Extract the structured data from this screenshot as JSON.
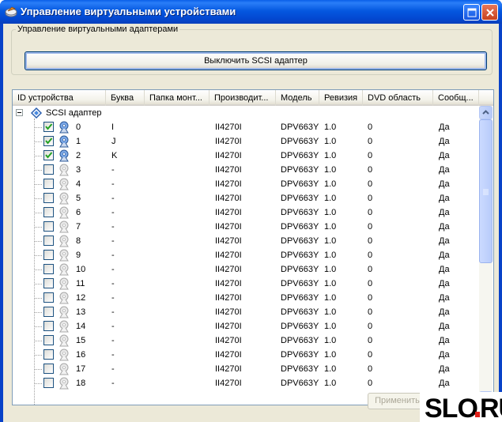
{
  "window": {
    "title": "Управление виртуальными устройствами"
  },
  "adapters_group": {
    "label": "Управление виртуальными адаптерами",
    "disable_button": "Выключить SCSI адаптер"
  },
  "columns": [
    "ID устройства",
    "Буква",
    "Папка монт...",
    "Производит...",
    "Модель",
    "Ревизия",
    "DVD область",
    "Сообщ..."
  ],
  "tree_root": "SCSI адаптер",
  "devices": [
    {
      "id": "0",
      "letter": "I",
      "folder": "",
      "vendor": "II4270I",
      "model": "DPV663Y",
      "revision": "1.0",
      "dvd_region": "0",
      "notify": "Да",
      "checked": true
    },
    {
      "id": "1",
      "letter": "J",
      "folder": "",
      "vendor": "II4270I",
      "model": "DPV663Y",
      "revision": "1.0",
      "dvd_region": "0",
      "notify": "Да",
      "checked": true
    },
    {
      "id": "2",
      "letter": "K",
      "folder": "",
      "vendor": "II4270I",
      "model": "DPV663Y",
      "revision": "1.0",
      "dvd_region": "0",
      "notify": "Да",
      "checked": true
    },
    {
      "id": "3",
      "letter": "-",
      "folder": "",
      "vendor": "II4270I",
      "model": "DPV663Y",
      "revision": "1.0",
      "dvd_region": "0",
      "notify": "Да",
      "checked": false
    },
    {
      "id": "4",
      "letter": "-",
      "folder": "",
      "vendor": "II4270I",
      "model": "DPV663Y",
      "revision": "1.0",
      "dvd_region": "0",
      "notify": "Да",
      "checked": false
    },
    {
      "id": "5",
      "letter": "-",
      "folder": "",
      "vendor": "II4270I",
      "model": "DPV663Y",
      "revision": "1.0",
      "dvd_region": "0",
      "notify": "Да",
      "checked": false
    },
    {
      "id": "6",
      "letter": "-",
      "folder": "",
      "vendor": "II4270I",
      "model": "DPV663Y",
      "revision": "1.0",
      "dvd_region": "0",
      "notify": "Да",
      "checked": false
    },
    {
      "id": "7",
      "letter": "-",
      "folder": "",
      "vendor": "II4270I",
      "model": "DPV663Y",
      "revision": "1.0",
      "dvd_region": "0",
      "notify": "Да",
      "checked": false
    },
    {
      "id": "8",
      "letter": "-",
      "folder": "",
      "vendor": "II4270I",
      "model": "DPV663Y",
      "revision": "1.0",
      "dvd_region": "0",
      "notify": "Да",
      "checked": false
    },
    {
      "id": "9",
      "letter": "-",
      "folder": "",
      "vendor": "II4270I",
      "model": "DPV663Y",
      "revision": "1.0",
      "dvd_region": "0",
      "notify": "Да",
      "checked": false
    },
    {
      "id": "10",
      "letter": "-",
      "folder": "",
      "vendor": "II4270I",
      "model": "DPV663Y",
      "revision": "1.0",
      "dvd_region": "0",
      "notify": "Да",
      "checked": false
    },
    {
      "id": "11",
      "letter": "-",
      "folder": "",
      "vendor": "II4270I",
      "model": "DPV663Y",
      "revision": "1.0",
      "dvd_region": "0",
      "notify": "Да",
      "checked": false
    },
    {
      "id": "12",
      "letter": "-",
      "folder": "",
      "vendor": "II4270I",
      "model": "DPV663Y",
      "revision": "1.0",
      "dvd_region": "0",
      "notify": "Да",
      "checked": false
    },
    {
      "id": "13",
      "letter": "-",
      "folder": "",
      "vendor": "II4270I",
      "model": "DPV663Y",
      "revision": "1.0",
      "dvd_region": "0",
      "notify": "Да",
      "checked": false
    },
    {
      "id": "14",
      "letter": "-",
      "folder": "",
      "vendor": "II4270I",
      "model": "DPV663Y",
      "revision": "1.0",
      "dvd_region": "0",
      "notify": "Да",
      "checked": false
    },
    {
      "id": "15",
      "letter": "-",
      "folder": "",
      "vendor": "II4270I",
      "model": "DPV663Y",
      "revision": "1.0",
      "dvd_region": "0",
      "notify": "Да",
      "checked": false
    },
    {
      "id": "16",
      "letter": "-",
      "folder": "",
      "vendor": "II4270I",
      "model": "DPV663Y",
      "revision": "1.0",
      "dvd_region": "0",
      "notify": "Да",
      "checked": false
    },
    {
      "id": "17",
      "letter": "-",
      "folder": "",
      "vendor": "II4270I",
      "model": "DPV663Y",
      "revision": "1.0",
      "dvd_region": "0",
      "notify": "Да",
      "checked": false
    },
    {
      "id": "18",
      "letter": "-",
      "folder": "",
      "vendor": "II4270I",
      "model": "DPV663Y",
      "revision": "1.0",
      "dvd_region": "0",
      "notify": "Да",
      "checked": false
    }
  ],
  "footer": {
    "apply_button": "Применить"
  },
  "watermark": {
    "text": "SLO.RU"
  },
  "colors": {
    "titlebar": "#0558e0",
    "face": "#ece9d8",
    "list_border": "#7f9db9"
  }
}
